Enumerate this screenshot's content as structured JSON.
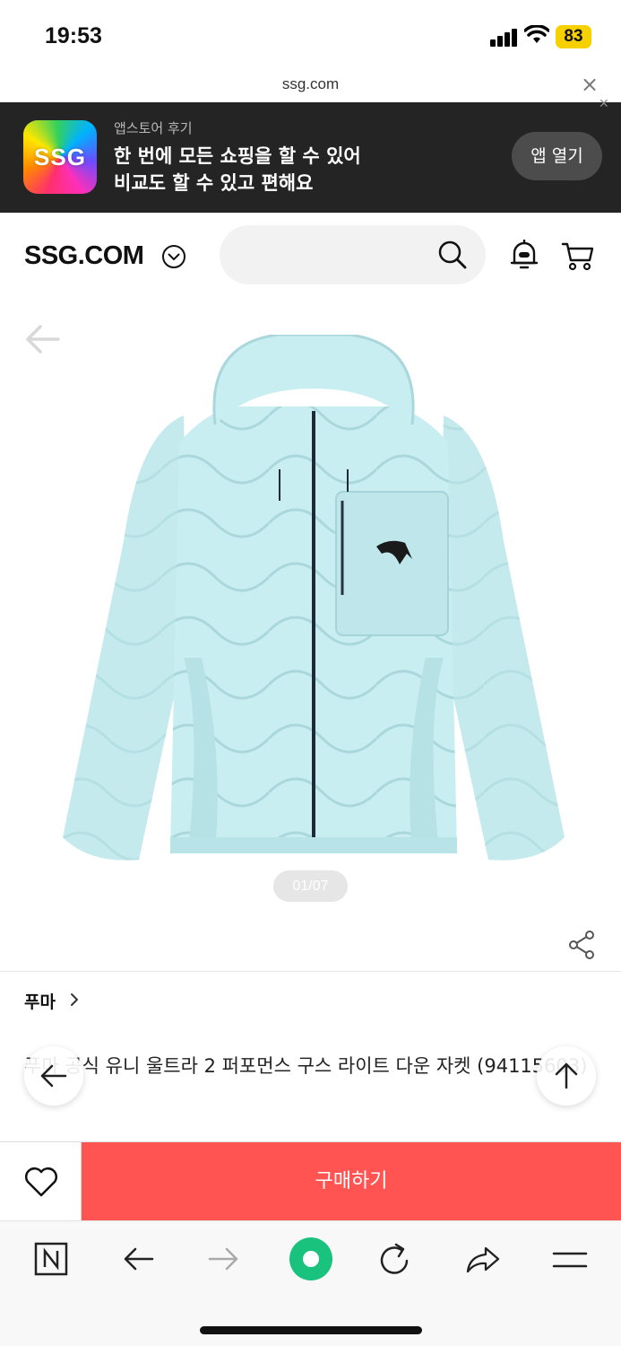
{
  "status_bar": {
    "time": "19:53",
    "battery": "83"
  },
  "url_bar": {
    "domain": "ssg.com",
    "close": "×"
  },
  "app_banner": {
    "logo_text": "SSG",
    "subtitle": "앱스토어 후기",
    "line1": "한 번에 모든 쇼핑을 할 수 있어",
    "line2": "비교도 할 수 있고 편해요",
    "open_button": "앱 열기"
  },
  "header": {
    "logo": "SSG.COM"
  },
  "product": {
    "image_counter": "01/07",
    "brand": "푸마",
    "title": "푸마 공식 유니 울트라 2 퍼포먼스 구스 라이트 다운 자켓 (94115603)"
  },
  "purchase": {
    "buy_label": "구매하기"
  },
  "colors": {
    "buy_button": "#ff5452",
    "banner_bg": "#242424",
    "jacket": "#bfe8ec",
    "battery": "#f7d000",
    "refresh_green": "#19c37d"
  }
}
